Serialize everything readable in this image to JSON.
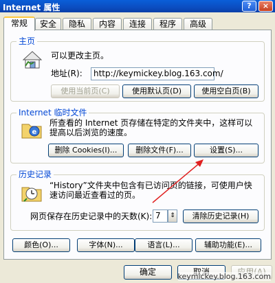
{
  "window": {
    "title": "Internet 属性",
    "help_glyph": "?",
    "close_glyph": "×"
  },
  "tabs": [
    {
      "label": "常规",
      "active": true
    },
    {
      "label": "安全"
    },
    {
      "label": "隐私"
    },
    {
      "label": "内容"
    },
    {
      "label": "连接"
    },
    {
      "label": "程序"
    },
    {
      "label": "高级"
    }
  ],
  "homepage": {
    "legend": "主页",
    "description": "可以更改主页。",
    "address_label": "地址(R):",
    "address_value": "http://keymickey.blog.163.com/",
    "use_current": "使用当前页(C)",
    "use_default": "使用默认页(D)",
    "use_blank": "使用空白页(B)"
  },
  "temp_files": {
    "legend": "Internet 临时文件",
    "description_line1": "所查看的 Internet 页存储在特定的文件夹中，这样可以",
    "description_line2": "提高以后浏览的速度。",
    "delete_cookies": "删除 Cookies(I)...",
    "delete_files": "删除文件(F)...",
    "settings": "设置(S)..."
  },
  "history": {
    "legend": "历史记录",
    "description_line1": "“History”文件夹中包含有已访问页的链接，可使用户快",
    "description_line2": "速访问最近查看过的页。",
    "days_label": "网页保存在历史记录中的天数(K):",
    "days_value": "7",
    "spin_glyph": "⇕",
    "clear": "清除历史记录(H)"
  },
  "bottom_buttons": {
    "colors": "颜色(O)...",
    "fonts": "字体(N)...",
    "languages": "语言(L)...",
    "accessibility": "辅助功能(E)..."
  },
  "footer": {
    "ok": "确定",
    "cancel": "取消",
    "apply": "应用(A)"
  },
  "watermark": "keymickey.blog.163.com",
  "colors": {
    "accent": "#0046d5",
    "annotation_arrow": "#e02020"
  }
}
